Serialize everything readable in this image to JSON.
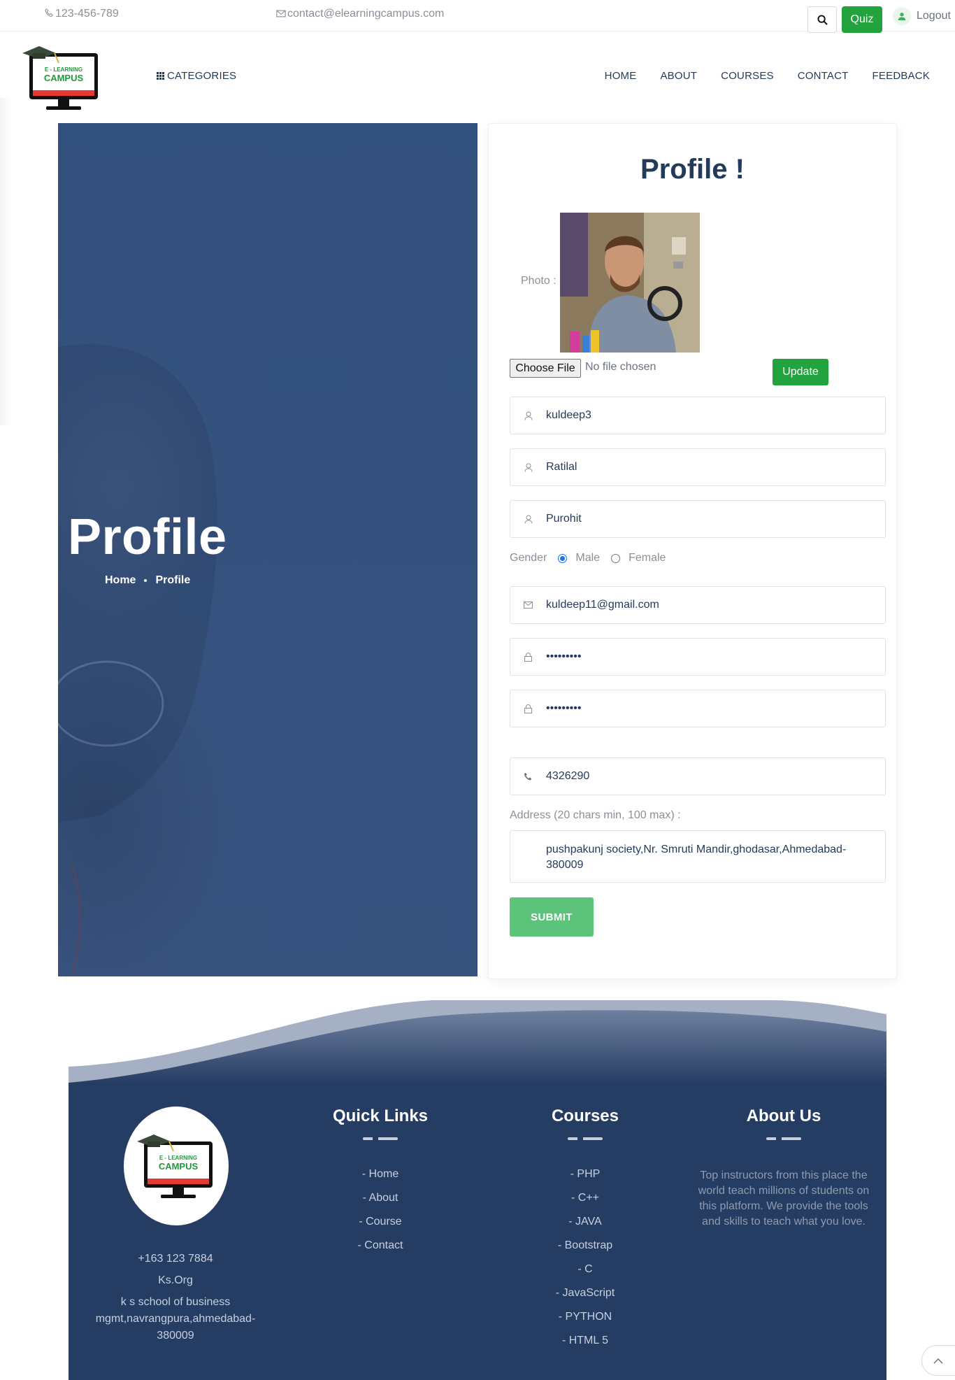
{
  "topbar": {
    "phone": "123-456-789",
    "email": "contact@elearningcampus.com",
    "quiz_label": "Quiz",
    "logout_label": "Logout"
  },
  "nav": {
    "logo_line1": "E - LEARNING",
    "logo_line2": "CAMPUS",
    "categories_label": "CATEGORIES",
    "items": [
      "HOME",
      "ABOUT",
      "COURSES",
      "CONTACT",
      "FEEDBACK"
    ]
  },
  "hero": {
    "title": "Profile",
    "breadcrumb": [
      "Home",
      "Profile"
    ]
  },
  "form": {
    "title": "Profile !",
    "photo_label": "Photo :",
    "choose_file_label": "Choose File",
    "no_file_text": "No file chosen",
    "update_label": "Update",
    "username": "kuldeep3",
    "middle_name": "Ratilal",
    "last_name": "Purohit",
    "gender_label": "Gender",
    "gender_options": [
      "Male",
      "Female"
    ],
    "gender_selected": "Male",
    "email": "kuldeep11@gmail.com",
    "password_mask": "•••••••••",
    "confirm_password_mask": "•••••••••",
    "phone": "4326290",
    "address_label": "Address (20 chars min, 100 max) :",
    "address": "pushpakunj society,Nr. Smruti Mandir,ghodasar,Ahmedabad-380009",
    "submit_label": "SUBMIT"
  },
  "footer": {
    "logo_line1": "E - LEARNING",
    "logo_line2": "CAMPUS",
    "contact_phone": "+163 123 7884",
    "org": "Ks.Org",
    "address": "k s school of business mgmt,navrangpura,ahmedabad-380009",
    "quick_links_title": "Quick Links",
    "quick_links": [
      "-  Home",
      "-  About",
      "-  Course",
      "-  Contact"
    ],
    "courses_title": "Courses",
    "courses": [
      "-  PHP",
      "-  C++",
      "-  JAVA",
      "-  Bootstrap",
      "-  C",
      "-  JavaScript",
      "-  PYTHON",
      "-  HTML 5"
    ],
    "about_title": "About Us",
    "about_text": "Top instructors from this place the world teach millions of students on this platform. We provide the tools and skills to teach what you love."
  },
  "colors": {
    "brand_green": "#23a33d",
    "navy": "#233a5b",
    "footer_bg": "#253c63",
    "submit_green": "#5cc37a"
  },
  "icons": [
    "phone-icon",
    "mail-icon",
    "search-icon",
    "user-icon",
    "lock-icon",
    "grid-icon",
    "chevron-up-icon"
  ]
}
